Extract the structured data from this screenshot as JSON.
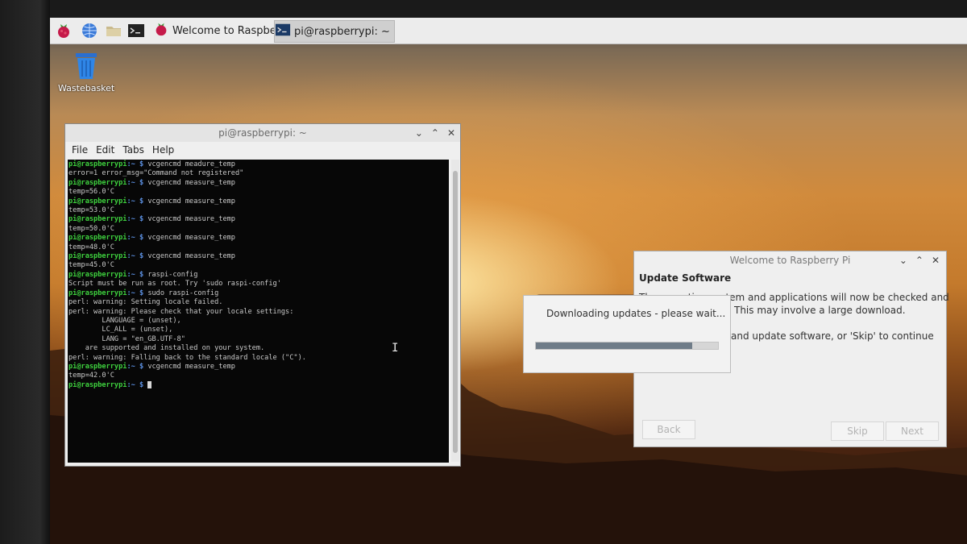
{
  "taskbar": {
    "launchers": [
      "raspberry-menu-icon",
      "web-browser-icon",
      "file-manager-icon",
      "terminal-icon"
    ],
    "tasks": [
      {
        "label": "Welcome to Raspberr...",
        "icon": "raspberry-icon"
      },
      {
        "label": "pi@raspberrypi: ~",
        "icon": "terminal-icon"
      }
    ]
  },
  "desktop": {
    "wastebasket_label": "Wastebasket"
  },
  "terminal": {
    "title": "pi@raspberrypi: ~",
    "menu": [
      "File",
      "Edit",
      "Tabs",
      "Help"
    ],
    "prompt_user": "pi@raspberrypi",
    "prompt_path": ":~ $ ",
    "lines": [
      {
        "type": "cmd",
        "text": "vcgencmd meadure_temp"
      },
      {
        "type": "out",
        "text": "error=1 error_msg=\"Command not registered\""
      },
      {
        "type": "cmd",
        "text": "vcgencmd measure_temp"
      },
      {
        "type": "out",
        "text": "temp=56.0'C"
      },
      {
        "type": "cmd",
        "text": "vcgencmd measure_temp"
      },
      {
        "type": "out",
        "text": "temp=53.0'C"
      },
      {
        "type": "cmd",
        "text": "vcgencmd measure_temp"
      },
      {
        "type": "out",
        "text": "temp=50.0'C"
      },
      {
        "type": "cmd",
        "text": "vcgencmd measure_temp"
      },
      {
        "type": "out",
        "text": "temp=48.0'C"
      },
      {
        "type": "cmd",
        "text": "vcgencmd measure_temp"
      },
      {
        "type": "out",
        "text": "temp=45.0'C"
      },
      {
        "type": "cmd",
        "text": "raspi-config"
      },
      {
        "type": "out",
        "text": "Script must be run as root. Try 'sudo raspi-config'"
      },
      {
        "type": "cmd",
        "text": "sudo raspi-config"
      },
      {
        "type": "out",
        "text": "perl: warning: Setting locale failed."
      },
      {
        "type": "out",
        "text": "perl: warning: Please check that your locale settings:"
      },
      {
        "type": "out",
        "text": "        LANGUAGE = (unset),"
      },
      {
        "type": "out",
        "text": "        LC_ALL = (unset),"
      },
      {
        "type": "out",
        "text": "        LANG = \"en_GB.UTF-8\""
      },
      {
        "type": "out",
        "text": "    are supported and installed on your system."
      },
      {
        "type": "out",
        "text": "perl: warning: Falling back to the standard locale (\"C\")."
      },
      {
        "type": "cmd",
        "text": "vcgencmd measure_temp"
      },
      {
        "type": "out",
        "text": "temp=42.0'C"
      },
      {
        "type": "cursor",
        "text": ""
      }
    ]
  },
  "welcome": {
    "title": "Welcome to Raspberry Pi",
    "heading": "Update Software",
    "line1": "The operating system and applications will now be checked and",
    "line2": "This may involve a large download.",
    "line3": "and update software, or 'Skip' to continue",
    "back_label": "Back",
    "skip_label": "Skip",
    "next_label": "Next"
  },
  "progress": {
    "message": "Downloading updates - please wait...",
    "fraction": 0.86
  },
  "colors": {
    "prompt_user": "#3ed13e",
    "prompt_path": "#5b8fe0",
    "progress_fill": "#6f7c88"
  }
}
